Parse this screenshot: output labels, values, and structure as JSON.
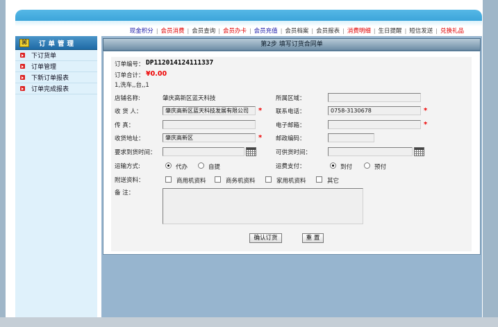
{
  "topnav": {
    "items": [
      {
        "label": "现金积分",
        "color": "#1a1aa8"
      },
      {
        "label": "会员消费",
        "color": "#e00000"
      },
      {
        "label": "会员查询",
        "color": "#333333"
      },
      {
        "label": "会员办卡",
        "color": "#e00000"
      },
      {
        "label": "会员充值",
        "color": "#1a1aa8"
      },
      {
        "label": "会员档案",
        "color": "#333333"
      },
      {
        "label": "会员报表",
        "color": "#333333"
      },
      {
        "label": "消费明细",
        "color": "#e00000"
      },
      {
        "label": "生日提醒",
        "color": "#333333"
      },
      {
        "label": "短信发送",
        "color": "#333333"
      },
      {
        "label": "兑换礼品",
        "color": "#e00000"
      }
    ],
    "separator": "|"
  },
  "sidebar": {
    "title": "订单管理",
    "logo_char": "⌘",
    "items": [
      {
        "label": "下订货单"
      },
      {
        "label": "订单管理"
      },
      {
        "label": "下新订单报表"
      },
      {
        "label": "订单完成报表"
      }
    ]
  },
  "main": {
    "title": "第2步  填写订货合同单"
  },
  "form": {
    "order_no_label": "订单编号：",
    "order_no": "DP112014124111337",
    "order_total_label": "订单合计：",
    "order_total": "¥0.00",
    "items_line": "1,洗车,,台,,1",
    "store_name_label": "店铺名称:",
    "store_name": "肇庆高新区蓝天科技",
    "region_label": "所属区域：",
    "region_value": "",
    "recipient_label": "收 货 人：",
    "recipient_value": "肇庆高新区蓝天科技发展有限公司",
    "phone_label": "联系电话：",
    "phone_value": "0758-3130678",
    "fax_label": "传    真：",
    "fax_value": "",
    "email_label": "电子邮箱：",
    "email_value": "",
    "address_label": "收货地址：",
    "address_value": "肇庆高新区",
    "postcode_label": "邮政编码：",
    "postcode_value": "",
    "delivery_time_label": "要求到货时间：",
    "delivery_time_value": "",
    "supply_time_label": "可供货时间：",
    "supply_time_value": "",
    "shipping_label": "运输方式:",
    "shipping_options": [
      "代办",
      "自提"
    ],
    "shipping_selected": "代办",
    "freight_label": "运费支付：",
    "freight_options": [
      "到付",
      "预付"
    ],
    "freight_selected": "到付",
    "attach_label": "附送资料：",
    "attach_options": [
      "商用机资料",
      "商务机资料",
      "家用机资料",
      "其它"
    ],
    "remark_label": "备    注：",
    "remark_value": "",
    "required_mark": "*",
    "confirm_button": "确认订货",
    "reset_button": "重 置"
  }
}
